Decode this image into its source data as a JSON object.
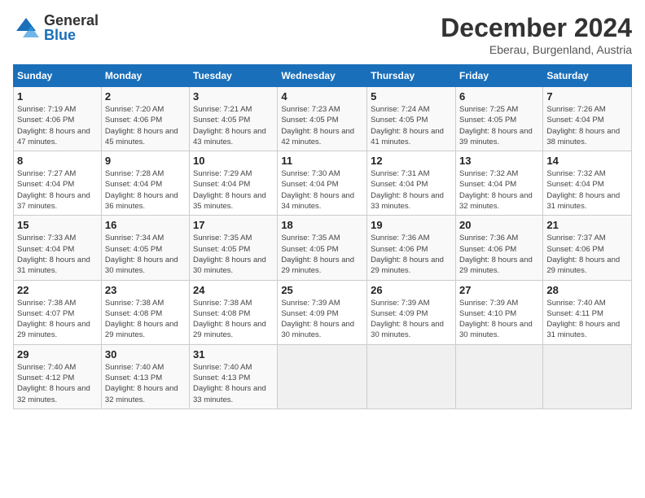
{
  "logo": {
    "general": "General",
    "blue": "Blue"
  },
  "header": {
    "month": "December 2024",
    "location": "Eberau, Burgenland, Austria"
  },
  "weekdays": [
    "Sunday",
    "Monday",
    "Tuesday",
    "Wednesday",
    "Thursday",
    "Friday",
    "Saturday"
  ],
  "weeks": [
    [
      {
        "day": "1",
        "sunrise": "Sunrise: 7:19 AM",
        "sunset": "Sunset: 4:06 PM",
        "daylight": "Daylight: 8 hours and 47 minutes."
      },
      {
        "day": "2",
        "sunrise": "Sunrise: 7:20 AM",
        "sunset": "Sunset: 4:06 PM",
        "daylight": "Daylight: 8 hours and 45 minutes."
      },
      {
        "day": "3",
        "sunrise": "Sunrise: 7:21 AM",
        "sunset": "Sunset: 4:05 PM",
        "daylight": "Daylight: 8 hours and 43 minutes."
      },
      {
        "day": "4",
        "sunrise": "Sunrise: 7:23 AM",
        "sunset": "Sunset: 4:05 PM",
        "daylight": "Daylight: 8 hours and 42 minutes."
      },
      {
        "day": "5",
        "sunrise": "Sunrise: 7:24 AM",
        "sunset": "Sunset: 4:05 PM",
        "daylight": "Daylight: 8 hours and 41 minutes."
      },
      {
        "day": "6",
        "sunrise": "Sunrise: 7:25 AM",
        "sunset": "Sunset: 4:05 PM",
        "daylight": "Daylight: 8 hours and 39 minutes."
      },
      {
        "day": "7",
        "sunrise": "Sunrise: 7:26 AM",
        "sunset": "Sunset: 4:04 PM",
        "daylight": "Daylight: 8 hours and 38 minutes."
      }
    ],
    [
      {
        "day": "8",
        "sunrise": "Sunrise: 7:27 AM",
        "sunset": "Sunset: 4:04 PM",
        "daylight": "Daylight: 8 hours and 37 minutes."
      },
      {
        "day": "9",
        "sunrise": "Sunrise: 7:28 AM",
        "sunset": "Sunset: 4:04 PM",
        "daylight": "Daylight: 8 hours and 36 minutes."
      },
      {
        "day": "10",
        "sunrise": "Sunrise: 7:29 AM",
        "sunset": "Sunset: 4:04 PM",
        "daylight": "Daylight: 8 hours and 35 minutes."
      },
      {
        "day": "11",
        "sunrise": "Sunrise: 7:30 AM",
        "sunset": "Sunset: 4:04 PM",
        "daylight": "Daylight: 8 hours and 34 minutes."
      },
      {
        "day": "12",
        "sunrise": "Sunrise: 7:31 AM",
        "sunset": "Sunset: 4:04 PM",
        "daylight": "Daylight: 8 hours and 33 minutes."
      },
      {
        "day": "13",
        "sunrise": "Sunrise: 7:32 AM",
        "sunset": "Sunset: 4:04 PM",
        "daylight": "Daylight: 8 hours and 32 minutes."
      },
      {
        "day": "14",
        "sunrise": "Sunrise: 7:32 AM",
        "sunset": "Sunset: 4:04 PM",
        "daylight": "Daylight: 8 hours and 31 minutes."
      }
    ],
    [
      {
        "day": "15",
        "sunrise": "Sunrise: 7:33 AM",
        "sunset": "Sunset: 4:04 PM",
        "daylight": "Daylight: 8 hours and 31 minutes."
      },
      {
        "day": "16",
        "sunrise": "Sunrise: 7:34 AM",
        "sunset": "Sunset: 4:05 PM",
        "daylight": "Daylight: 8 hours and 30 minutes."
      },
      {
        "day": "17",
        "sunrise": "Sunrise: 7:35 AM",
        "sunset": "Sunset: 4:05 PM",
        "daylight": "Daylight: 8 hours and 30 minutes."
      },
      {
        "day": "18",
        "sunrise": "Sunrise: 7:35 AM",
        "sunset": "Sunset: 4:05 PM",
        "daylight": "Daylight: 8 hours and 29 minutes."
      },
      {
        "day": "19",
        "sunrise": "Sunrise: 7:36 AM",
        "sunset": "Sunset: 4:06 PM",
        "daylight": "Daylight: 8 hours and 29 minutes."
      },
      {
        "day": "20",
        "sunrise": "Sunrise: 7:36 AM",
        "sunset": "Sunset: 4:06 PM",
        "daylight": "Daylight: 8 hours and 29 minutes."
      },
      {
        "day": "21",
        "sunrise": "Sunrise: 7:37 AM",
        "sunset": "Sunset: 4:06 PM",
        "daylight": "Daylight: 8 hours and 29 minutes."
      }
    ],
    [
      {
        "day": "22",
        "sunrise": "Sunrise: 7:38 AM",
        "sunset": "Sunset: 4:07 PM",
        "daylight": "Daylight: 8 hours and 29 minutes."
      },
      {
        "day": "23",
        "sunrise": "Sunrise: 7:38 AM",
        "sunset": "Sunset: 4:08 PM",
        "daylight": "Daylight: 8 hours and 29 minutes."
      },
      {
        "day": "24",
        "sunrise": "Sunrise: 7:38 AM",
        "sunset": "Sunset: 4:08 PM",
        "daylight": "Daylight: 8 hours and 29 minutes."
      },
      {
        "day": "25",
        "sunrise": "Sunrise: 7:39 AM",
        "sunset": "Sunset: 4:09 PM",
        "daylight": "Daylight: 8 hours and 30 minutes."
      },
      {
        "day": "26",
        "sunrise": "Sunrise: 7:39 AM",
        "sunset": "Sunset: 4:09 PM",
        "daylight": "Daylight: 8 hours and 30 minutes."
      },
      {
        "day": "27",
        "sunrise": "Sunrise: 7:39 AM",
        "sunset": "Sunset: 4:10 PM",
        "daylight": "Daylight: 8 hours and 30 minutes."
      },
      {
        "day": "28",
        "sunrise": "Sunrise: 7:40 AM",
        "sunset": "Sunset: 4:11 PM",
        "daylight": "Daylight: 8 hours and 31 minutes."
      }
    ],
    [
      {
        "day": "29",
        "sunrise": "Sunrise: 7:40 AM",
        "sunset": "Sunset: 4:12 PM",
        "daylight": "Daylight: 8 hours and 32 minutes."
      },
      {
        "day": "30",
        "sunrise": "Sunrise: 7:40 AM",
        "sunset": "Sunset: 4:13 PM",
        "daylight": "Daylight: 8 hours and 32 minutes."
      },
      {
        "day": "31",
        "sunrise": "Sunrise: 7:40 AM",
        "sunset": "Sunset: 4:13 PM",
        "daylight": "Daylight: 8 hours and 33 minutes."
      },
      null,
      null,
      null,
      null
    ]
  ]
}
